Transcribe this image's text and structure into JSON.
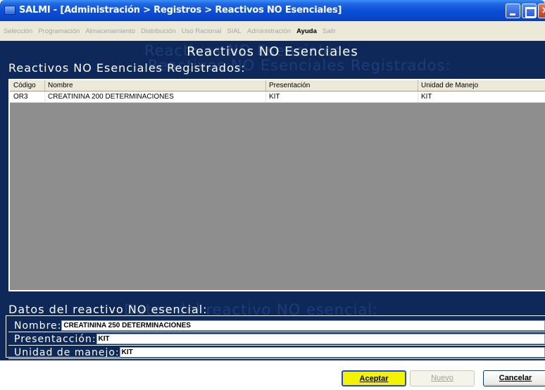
{
  "window": {
    "title": "SALMI - [Administración > Registros > Reactivos NO Esenciales]"
  },
  "menu": {
    "items": [
      "Selección",
      "Programación",
      "Almacenamiento",
      "Distribución",
      "Uso Racional",
      "SIAL",
      "Administración",
      "Ayuda",
      "Salir"
    ],
    "active_item": "Ayuda"
  },
  "header": {
    "ghost_title": "Reactivos NO Esenciales",
    "title": "Reactivos NO Esenciales",
    "ghost_subtitle": "Reactivos NO Esenciales Registrados:",
    "subtitle": "Reactivos NO Esenciales Registrados:"
  },
  "table": {
    "columns": [
      "Código",
      "Nombre",
      "Presentación",
      "Unidad de Manejo"
    ],
    "rows": [
      [
        "OR3",
        "CREATININA 200 DETERMINACIONES",
        "KIT",
        "KIT"
      ]
    ]
  },
  "form": {
    "ghost_title": "Datos del reactivo NO esencial:",
    "title": "Datos del reactivo NO esencial:",
    "nombre_label": "Nombre:",
    "nombre_value": "CREATININA 250 DETERMINACIONES",
    "presentacion_label": "Presentacción:",
    "presentacion_value": "KIT",
    "unidad_label": "Unidad de manejo:",
    "unidad_value": "KIT"
  },
  "buttons": {
    "aceptar": "Aceptar",
    "nuevo": "Nuevo",
    "cancelar": "Cancelar"
  },
  "colors": {
    "panel_bg": "#0D2859",
    "accept_bg": "#F3F300"
  }
}
